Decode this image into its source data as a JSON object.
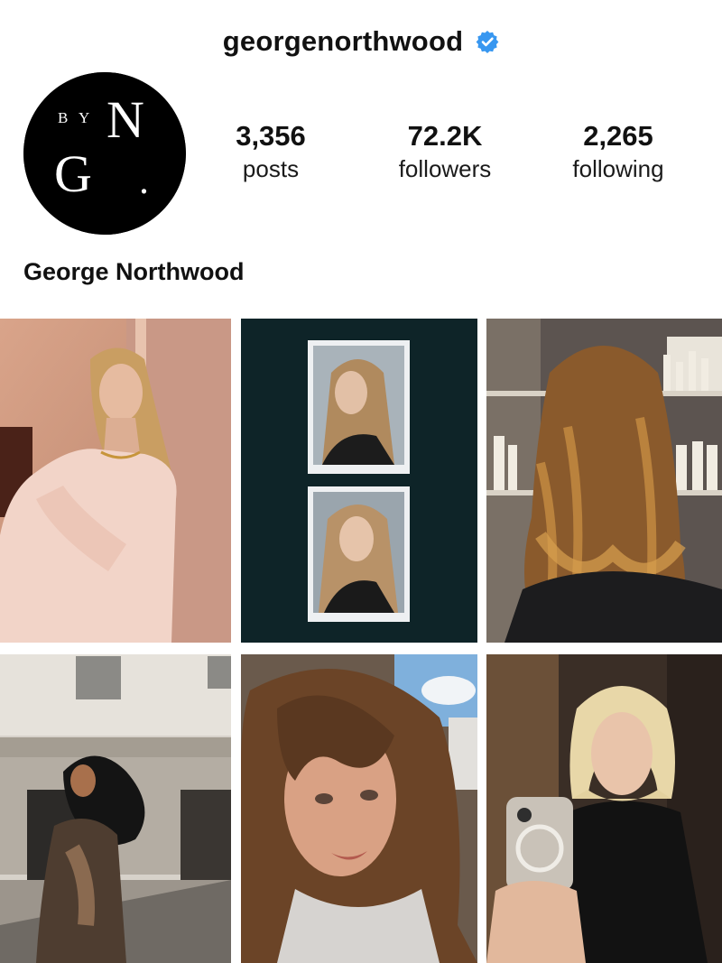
{
  "profile": {
    "username": "georgenorthwood",
    "full_name": "George Northwood",
    "avatar_text": {
      "top": "B Y",
      "n": "N",
      "g": "G",
      "dot": "."
    }
  },
  "stats": {
    "posts": {
      "value": "3,356",
      "label": "posts"
    },
    "followers": {
      "value": "72.2K",
      "label": "followers"
    },
    "following": {
      "value": "2,265",
      "label": "following"
    }
  },
  "icons": {
    "verified": "verified-badge-icon"
  },
  "colors": {
    "verified_blue": "#3897f0",
    "text": "#111111",
    "tile2_background": "#0e2428"
  },
  "posts": [
    {
      "name": "post-blonde-woman-pink-shirt"
    },
    {
      "name": "post-polaroid-portraits"
    },
    {
      "name": "post-wavy-brown-hair-salon"
    },
    {
      "name": "post-curly-hair-street"
    },
    {
      "name": "post-selfie-brunette"
    },
    {
      "name": "post-blonde-bob-mirror-selfie"
    }
  ]
}
